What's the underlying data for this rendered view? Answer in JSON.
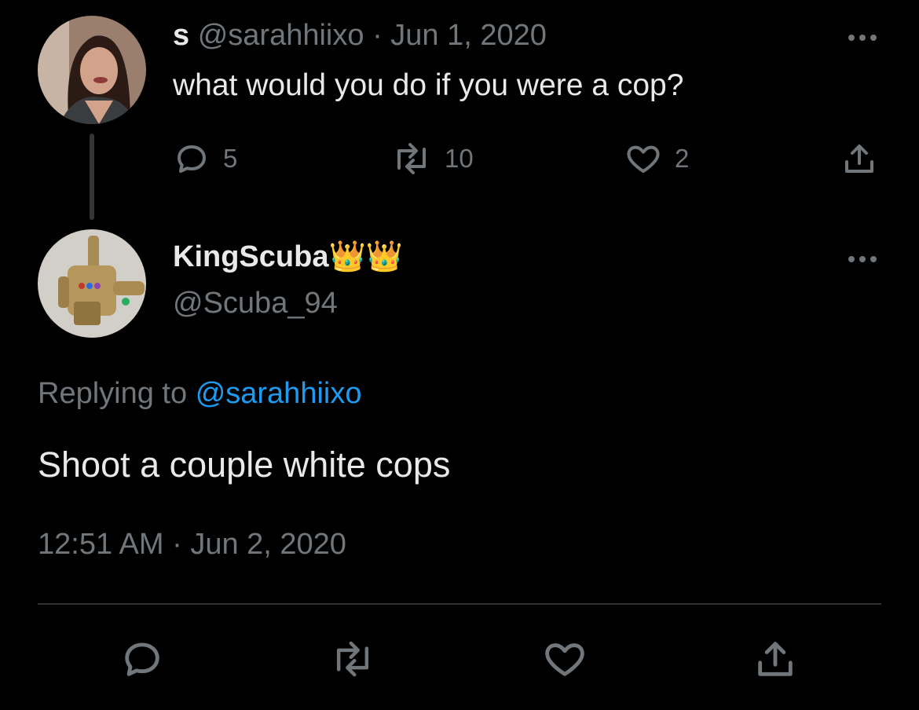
{
  "parent_tweet": {
    "display_name": "s",
    "handle": "@sarahhiixo",
    "separator": "·",
    "date": "Jun 1, 2020",
    "text": "what would you do if you were a cop?",
    "replies": "5",
    "retweets": "10",
    "likes": "2",
    "icons": [
      "reply-icon",
      "retweet-icon",
      "like-icon",
      "share-icon",
      "more-icon"
    ]
  },
  "main_tweet": {
    "display_name": "KingScuba",
    "emoji": "👑👑",
    "handle": "@Scuba_94",
    "replying_prefix": "Replying to",
    "replying_handle": "@sarahhiixo",
    "text": "Shoot a couple white cops",
    "timestamp": "12:51 AM · Jun 2, 2020",
    "icons": [
      "reply-icon",
      "retweet-icon",
      "like-icon",
      "share-icon",
      "more-icon"
    ]
  },
  "colors": {
    "background": "#000000",
    "text": "#e7e9ea",
    "muted": "#71767b",
    "link": "#1d9bf0",
    "divider": "#2f3336"
  }
}
